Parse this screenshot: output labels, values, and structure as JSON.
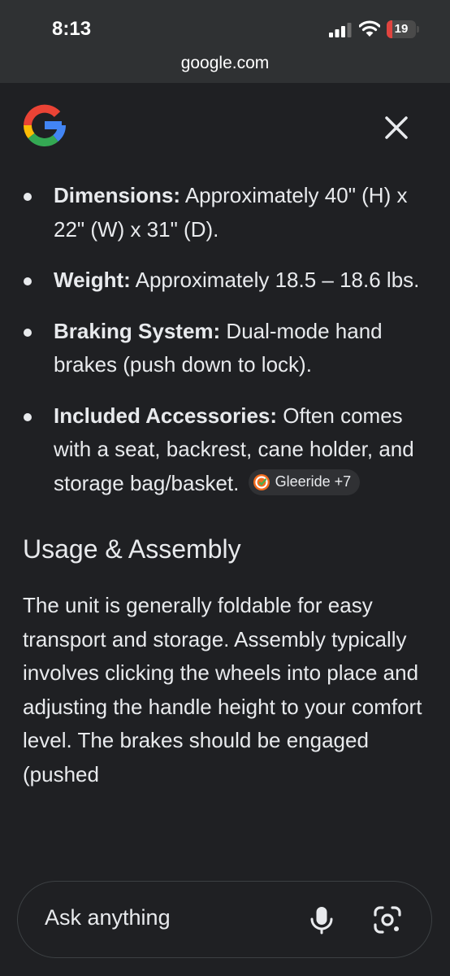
{
  "status_bar": {
    "time": "8:13",
    "battery_level": "19"
  },
  "browser": {
    "url": "google.com"
  },
  "icons": {
    "logo": "google-g-icon",
    "close": "close-icon",
    "mic": "mic-icon",
    "lens": "lens-icon"
  },
  "specs": [
    {
      "term": "Dimensions:",
      "text": " Approximately 40\" (H) x 22\" (W) x 31\" (D)."
    },
    {
      "term": "Weight:",
      "text": " Approximately 18.5 – 18.6 lbs."
    },
    {
      "term": "Braking System:",
      "text": " Dual-mode hand brakes (push down to lock)."
    },
    {
      "term": "Included Accessories:",
      "text": " Often comes with a seat, backrest, cane holder, and storage bag/basket."
    }
  ],
  "source_chip": {
    "label": "Gleeride +7"
  },
  "usage": {
    "heading": "Usage & Assembly",
    "body": "The unit is generally foldable for easy transport and storage. Assembly typically involves clicking the wheels into place and adjusting the handle height to your comfort level. The brakes should be engaged (pushed"
  },
  "ask_bar": {
    "placeholder": "Ask anything"
  },
  "colors": {
    "background": "#1f2023",
    "browser_chrome": "#2f3133",
    "battery_low": "#e0443f"
  }
}
